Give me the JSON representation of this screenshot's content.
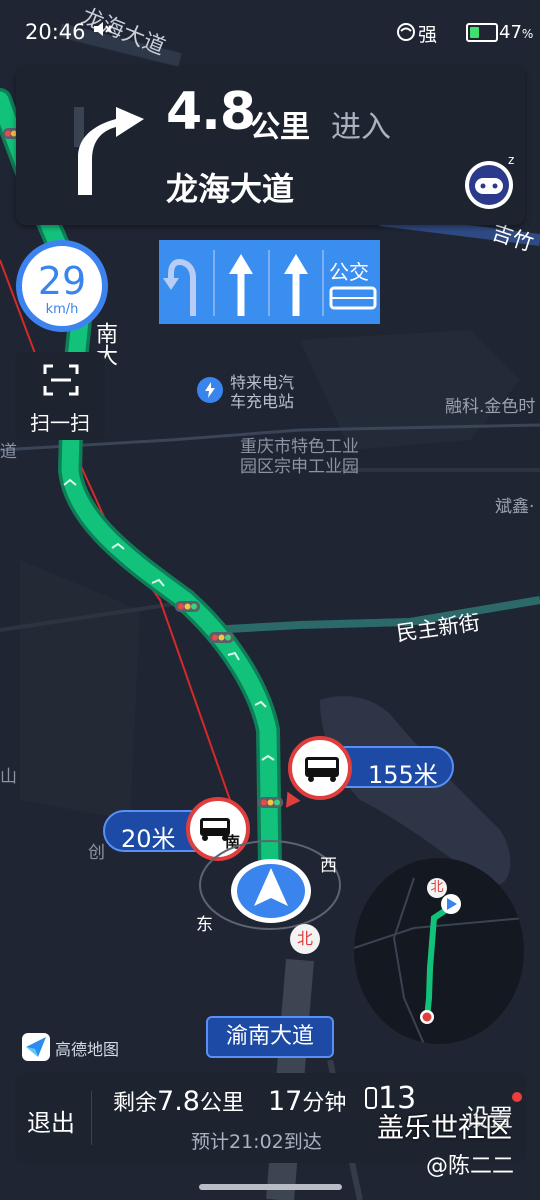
{
  "status_bar": {
    "time": "20:46",
    "mute_icon": "mute-icon",
    "signal_text": "强",
    "battery": "47",
    "battery_symbol": "%",
    "battery_level": 0.47
  },
  "maneuver": {
    "distance": "4.8",
    "unit": "公里",
    "action": "进入",
    "road": "龙海大道",
    "icon": "turn-right-arrow-icon"
  },
  "lane_guidance": {
    "label": "公交",
    "lanes": [
      "u-turn-left",
      "straight",
      "straight",
      "bus"
    ]
  },
  "speed": {
    "value": "29",
    "unit": "km/h"
  },
  "scan_button": {
    "label": "扫一扫"
  },
  "map_labels": {
    "road_top": "龙海大道",
    "road_left": "南大",
    "poi_name_1": "特来电汽",
    "poi_name_2": "车充电站",
    "industrial_1": "重庆市特色工业",
    "industrial_2": "园区宗申工业园",
    "right_1": "融科.金色时",
    "right_2": "斌鑫·",
    "right_road": "吉竹",
    "left_edge": "道",
    "left_edge_2": "山",
    "left_edge_3": "创",
    "minzhu": "民主新街"
  },
  "bus_stops": [
    {
      "distance": "155米"
    },
    {
      "distance": "20米",
      "direction": "南"
    }
  ],
  "compass": {
    "west": "西",
    "east": "东",
    "north": "北"
  },
  "current_road": "渝南大道",
  "logo_text": "高德地图",
  "bottom_bar": {
    "exit": "退出",
    "remaining_prefix": "剩余",
    "remaining_distance": "7.8",
    "remaining_unit": "公里",
    "remaining_minutes": "17",
    "minutes_unit": "分钟",
    "eta": "预计21:02到达",
    "clock": "13",
    "settings": "设置"
  },
  "watermark": "盖乐世社区",
  "credit": "@陈二二",
  "colors": {
    "route": "#12c27a",
    "accent": "#3a84ee",
    "alert": "#e03d3d",
    "panel": "#1d2430"
  }
}
